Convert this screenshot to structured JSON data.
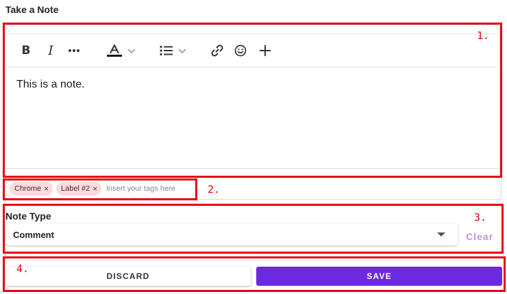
{
  "page": {
    "title": "Take a Note"
  },
  "toolbar": {
    "bold_label": "B",
    "italic_label": "I",
    "icons": {
      "more": "more-horizontal-icon",
      "text_color": "text-color-icon",
      "text_color_swatch": "#111111",
      "list": "bulleted-list-icon",
      "link": "link-icon",
      "emoji": "emoji-icon",
      "insert": "plus-icon"
    }
  },
  "editor": {
    "content": "This is a note."
  },
  "tags": {
    "chips": [
      {
        "label": "Chrome"
      },
      {
        "label": "Label #2"
      }
    ],
    "remove_glyph": "×",
    "placeholder": "Insert your tags here"
  },
  "note_type": {
    "label": "Note Type",
    "selected": "Comment",
    "clear_label": "Clear"
  },
  "actions": {
    "discard_label": "DISCARD",
    "save_label": "SAVE"
  },
  "annotations": {
    "marker_1": "1.",
    "marker_2": "2.",
    "marker_3": "3.",
    "marker_4": "4."
  },
  "colors": {
    "accent": "#6c2ae0",
    "clear_text": "#b99ad9",
    "chip_bg": "#fbdcdc",
    "annotation_red": "#e6000e"
  }
}
